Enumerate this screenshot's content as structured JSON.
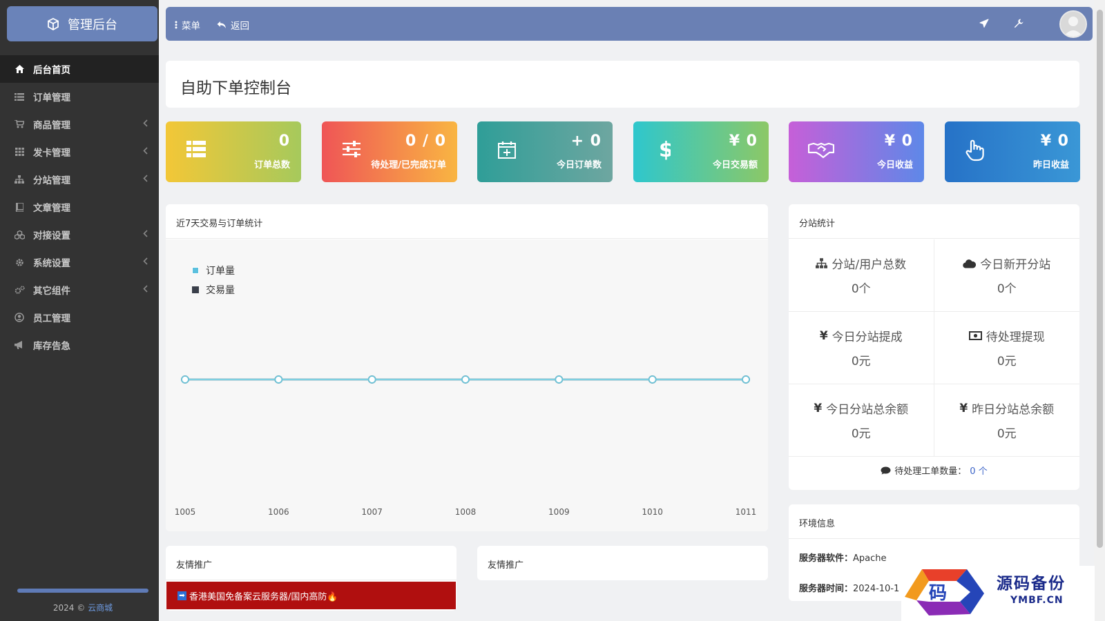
{
  "brand": {
    "title": "管理后台",
    "icon": "cube-icon"
  },
  "sidebar": {
    "items": [
      {
        "label": "后台首页",
        "icon": "home-icon",
        "active": true,
        "has_submenu": false
      },
      {
        "label": "订单管理",
        "icon": "list-icon",
        "active": false,
        "has_submenu": false
      },
      {
        "label": "商品管理",
        "icon": "cart-icon",
        "active": false,
        "has_submenu": true
      },
      {
        "label": "发卡管理",
        "icon": "grid-icon",
        "active": false,
        "has_submenu": true
      },
      {
        "label": "分站管理",
        "icon": "sitemap-icon",
        "active": false,
        "has_submenu": true
      },
      {
        "label": "文章管理",
        "icon": "book-icon",
        "active": false,
        "has_submenu": false
      },
      {
        "label": "对接设置",
        "icon": "cubes-icon",
        "active": false,
        "has_submenu": true
      },
      {
        "label": "系统设置",
        "icon": "gear-icon",
        "active": false,
        "has_submenu": true
      },
      {
        "label": "其它组件",
        "icon": "cogs-icon",
        "active": false,
        "has_submenu": true
      },
      {
        "label": "员工管理",
        "icon": "user-circle-icon",
        "active": false,
        "has_submenu": false
      },
      {
        "label": "库存告急",
        "icon": "megaphone-icon",
        "active": false,
        "has_submenu": false
      }
    ],
    "footer_year": "2024 ©",
    "footer_link": "云商城"
  },
  "topbar": {
    "menu_label": "菜单",
    "back_label": "返回",
    "icons": [
      "plane-icon",
      "wrench-icon",
      "avatar"
    ]
  },
  "page": {
    "title": "自助下单控制台"
  },
  "stats": [
    {
      "value": "0",
      "label": "订单总数",
      "icon": "list-icon",
      "colors": [
        "#f3c737",
        "#a6c95c"
      ]
    },
    {
      "value": "0 / 0",
      "label": "待处理/已完成订单",
      "icon": "sliders-icon",
      "colors": [
        "#ef5556",
        "#f9b542"
      ]
    },
    {
      "value": "+ 0",
      "label": "今日订单数",
      "icon": "calendar-plus-icon",
      "colors": [
        "#2f9e98",
        "#6ea6a0"
      ]
    },
    {
      "value": "¥ 0",
      "label": "今日交易额",
      "icon": "dollar-icon",
      "colors": [
        "#2ec7cd",
        "#8cc866"
      ]
    },
    {
      "value": "¥ 0",
      "label": "今日收益",
      "icon": "handshake-icon",
      "colors": [
        "#c65fd8",
        "#5e88e8"
      ]
    },
    {
      "value": "¥ 0",
      "label": "昨日收益",
      "icon": "hand-pointer-icon",
      "colors": [
        "#2672c7",
        "#3a97d6"
      ]
    }
  ],
  "trade_panel": {
    "title": "近7天交易与订单统计"
  },
  "chart_data": {
    "type": "line",
    "title": "",
    "x": [
      "1005",
      "1006",
      "1007",
      "1008",
      "1009",
      "1010",
      "1011"
    ],
    "series": [
      {
        "name": "订单量",
        "values": [
          0,
          0,
          0,
          0,
          0,
          0,
          0
        ],
        "color": "#5bc0de"
      },
      {
        "name": "交易量",
        "values": [
          0,
          0,
          0,
          0,
          0,
          0,
          0
        ],
        "color": "#3a3f4a"
      }
    ],
    "grid": false,
    "legend": "top-left"
  },
  "substation": {
    "title": "分站统计",
    "cells": [
      {
        "title": "分站/用户总数",
        "value": "0个",
        "icon": "sitemap-icon"
      },
      {
        "title": "今日新开分站",
        "value": "0个",
        "icon": "cloud-icon"
      },
      {
        "title": "今日分站提成",
        "value": "0元",
        "icon": "yen-icon"
      },
      {
        "title": "待处理提现",
        "value": "0元",
        "icon": "money-icon"
      },
      {
        "title": "今日分站总余额",
        "value": "0元",
        "icon": "yen-icon"
      },
      {
        "title": "昨日分站总余额",
        "value": "0元",
        "icon": "yen-icon"
      }
    ],
    "ticket_label": "待处理工单数量：",
    "ticket_count": "0 个"
  },
  "env": {
    "title": "环境信息",
    "rows": [
      {
        "label": "服务器软件：",
        "value": "Apache"
      },
      {
        "label": "服务器时间：",
        "value": "2024-10-1"
      }
    ]
  },
  "friends": [
    {
      "title": "友情推广",
      "promo": "香港美国免备案云服务器/国内高防🔥"
    },
    {
      "title": "友情推广",
      "promo": ""
    }
  ],
  "watermark": {
    "main": "源码备份",
    "sub": "YMBF.CN",
    "glyph": "码"
  }
}
